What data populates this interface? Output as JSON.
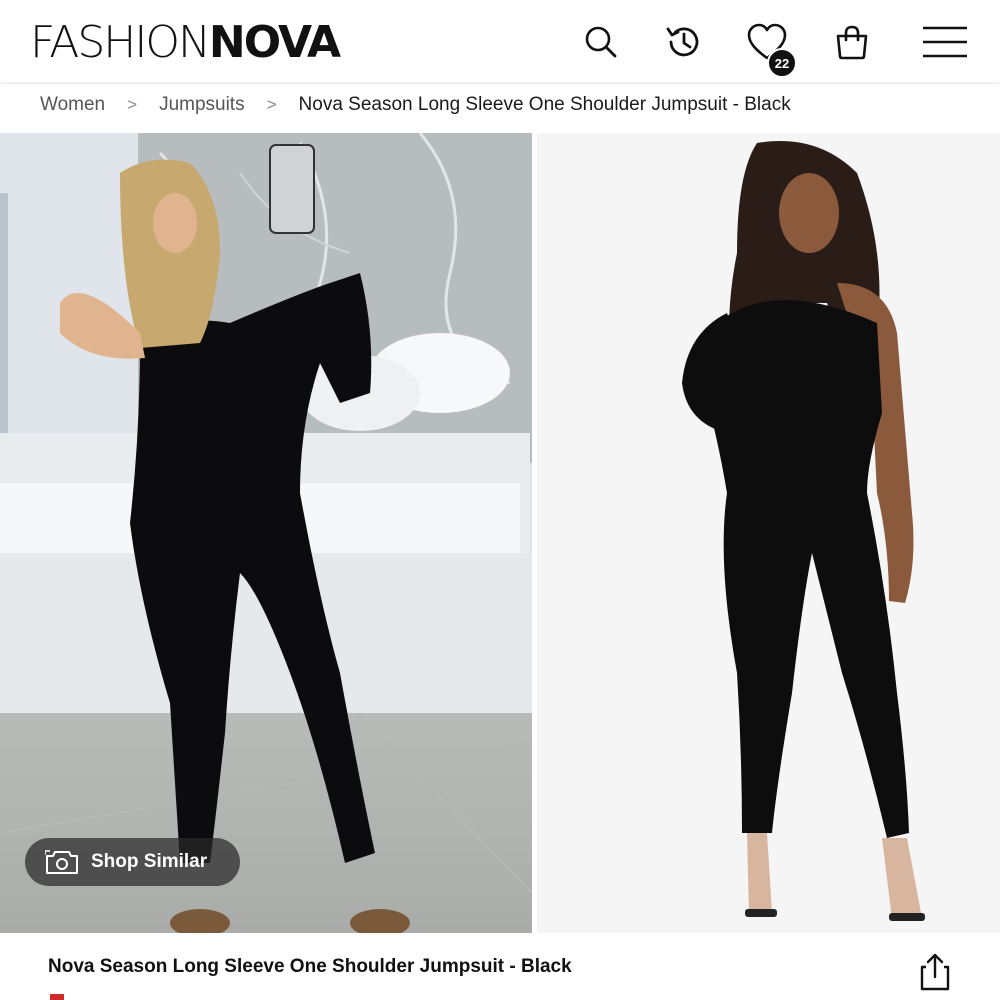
{
  "header": {
    "logo": {
      "part1": "FASHION",
      "part2": "NOVA"
    },
    "icons": [
      "search-icon",
      "history-icon",
      "wishlist-heart-icon",
      "shopping-bag-icon",
      "menu-icon"
    ],
    "wishlist_count": "22"
  },
  "breadcrumb": {
    "items": [
      "Women",
      "Jumpsuits",
      "Nova Season Long Sleeve One Shoulder Jumpsuit - Black"
    ]
  },
  "gallery": {
    "shop_similar_label": "Shop Similar",
    "shop_similar_icon": "camera-icon"
  },
  "product": {
    "title": "Nova Season Long Sleeve One Shoulder Jumpsuit - Black",
    "share_icon": "share-icon"
  },
  "colors": {
    "text": "#111111",
    "muted": "#555555",
    "accent": "#d02a2a"
  }
}
